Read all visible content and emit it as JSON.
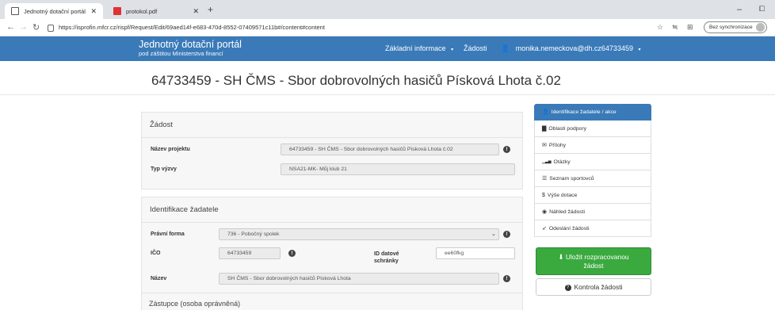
{
  "browser": {
    "tabs": [
      {
        "label": "Jednotný dotační portál"
      },
      {
        "label": "protokol.pdf"
      }
    ],
    "url": "https://isprofin.mfcr.cz/rispf/Request/Edit/69aed14f-e683-470d-8552-07409571c11b#/content#content",
    "sync_label": "Bez synchronizace"
  },
  "navbar": {
    "brand_title": "Jednotný dotační portál",
    "brand_subtitle": "pod záštitou Ministerstva financí",
    "menu_info": "Základní informace",
    "menu_requests": "Žádosti",
    "user": "monika.nemeckova@dh.cz64733459"
  },
  "page_title": "64733459 - SH ČMS - Sbor dobrovolných hasičů Písková Lhota č.02",
  "zadost": {
    "heading": "Žádost",
    "project_name_label": "Název projektu",
    "project_name_value": "64733459 - SH ČMS - Sbor dobrovolných hasičů Písková Lhota č.02",
    "call_type_label": "Typ výzvy",
    "call_type_value": "NSA21-MK- Můj klub 21"
  },
  "identifikace": {
    "heading": "Identifikace žadatele",
    "legal_form_label": "Právní forma",
    "legal_form_value": "736 - Pobočný spolek",
    "ico_label": "IČO",
    "ico_value": "64733459",
    "databox_label_1": "ID datové",
    "databox_label_2": "schránky",
    "databox_value": "ee60fkg",
    "name_label": "Název",
    "name_value": "SH ČMS - Sbor dobrovolných hasičů Písková Lhota"
  },
  "zastupce_heading": "Zástupce (osoba oprávněná)",
  "side_nav": [
    {
      "label": "Identifikace žadatele / akce",
      "icon": "user-icon",
      "glyph": "👤"
    },
    {
      "label": "Oblasti podpory",
      "icon": "book-icon",
      "glyph": "▇"
    },
    {
      "label": "Přílohy",
      "icon": "envelope-icon",
      "glyph": "✉"
    },
    {
      "label": "Otázky",
      "icon": "bar-chart-icon",
      "glyph": "▁▃▅"
    },
    {
      "label": "Seznam sportovců",
      "icon": "list-icon",
      "glyph": "☰"
    },
    {
      "label": "Výše dotace",
      "icon": "dollar-icon",
      "glyph": "$"
    },
    {
      "label": "Náhled žádosti",
      "icon": "eye-icon",
      "glyph": "◉"
    },
    {
      "label": "Odeslání žádosti",
      "icon": "send-icon",
      "glyph": "➶"
    }
  ],
  "buttons": {
    "save_line1": "Uložit rozpracovanou",
    "save_line2": "žádost",
    "check": "Kontrola žádosti"
  },
  "colors": {
    "navbar": "#3a7ab8",
    "save": "#3aaa3f"
  }
}
